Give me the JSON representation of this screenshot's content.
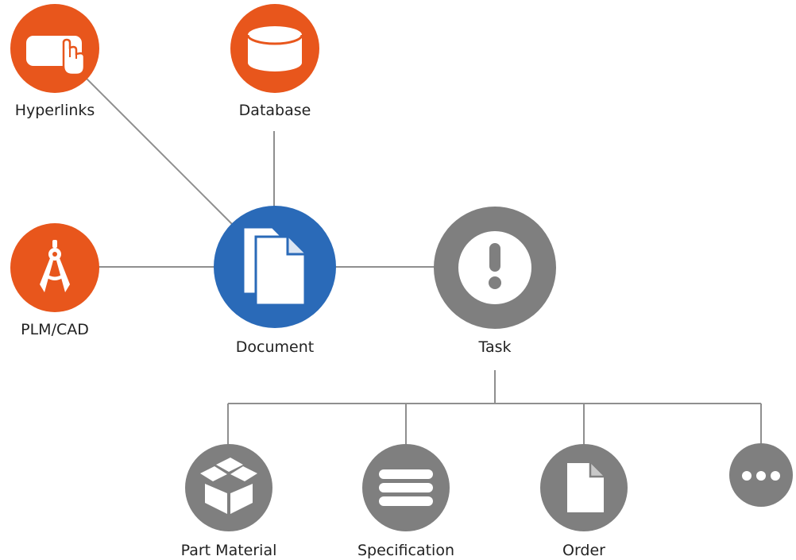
{
  "colors": {
    "orange": "#e8561c",
    "blue": "#2a6ab8",
    "gray": "#7f7f7f",
    "line": "#8f8f8f",
    "icon": "#ffffff"
  },
  "nodes": {
    "hyperlinks": {
      "label": "Hyperlinks",
      "icon": "pointing-hand-icon"
    },
    "database": {
      "label": "Database",
      "icon": "database-cylinder-icon"
    },
    "plm_cad": {
      "label": "PLM/CAD",
      "icon": "drafting-compass-icon"
    },
    "document": {
      "label": "Document",
      "icon": "document-stack-icon"
    },
    "task": {
      "label": "Task",
      "icon": "exclamation-icon"
    },
    "part_material": {
      "label": "Part Material",
      "icon": "open-box-icon"
    },
    "specification": {
      "label": "Specification",
      "icon": "lines-list-icon"
    },
    "order": {
      "label": "Order",
      "icon": "single-document-icon"
    },
    "more": {
      "label": "",
      "icon": "more-dots-icon"
    }
  }
}
